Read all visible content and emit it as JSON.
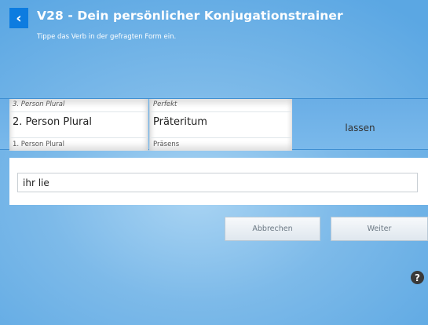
{
  "header": {
    "back_glyph": "‹",
    "title": "V28 - Dein persönlicher Konjugationstrainer",
    "subtitle": "Tippe das Verb in der gefragten Form ein."
  },
  "picker": {
    "person": {
      "above": "3. Person Plural",
      "selected": "2. Person Plural",
      "below": "1. Person Plural"
    },
    "tense": {
      "above": "Perfekt",
      "selected": "Präteritum",
      "below": "Präsens"
    },
    "verb": "lassen"
  },
  "answer": {
    "value": "ihr lie"
  },
  "buttons": {
    "cancel": "Abbrechen",
    "next": "Weiter"
  },
  "help": {
    "glyph": "?"
  },
  "colors": {
    "accent": "#0d7ce0",
    "background": "#7dbae9"
  }
}
